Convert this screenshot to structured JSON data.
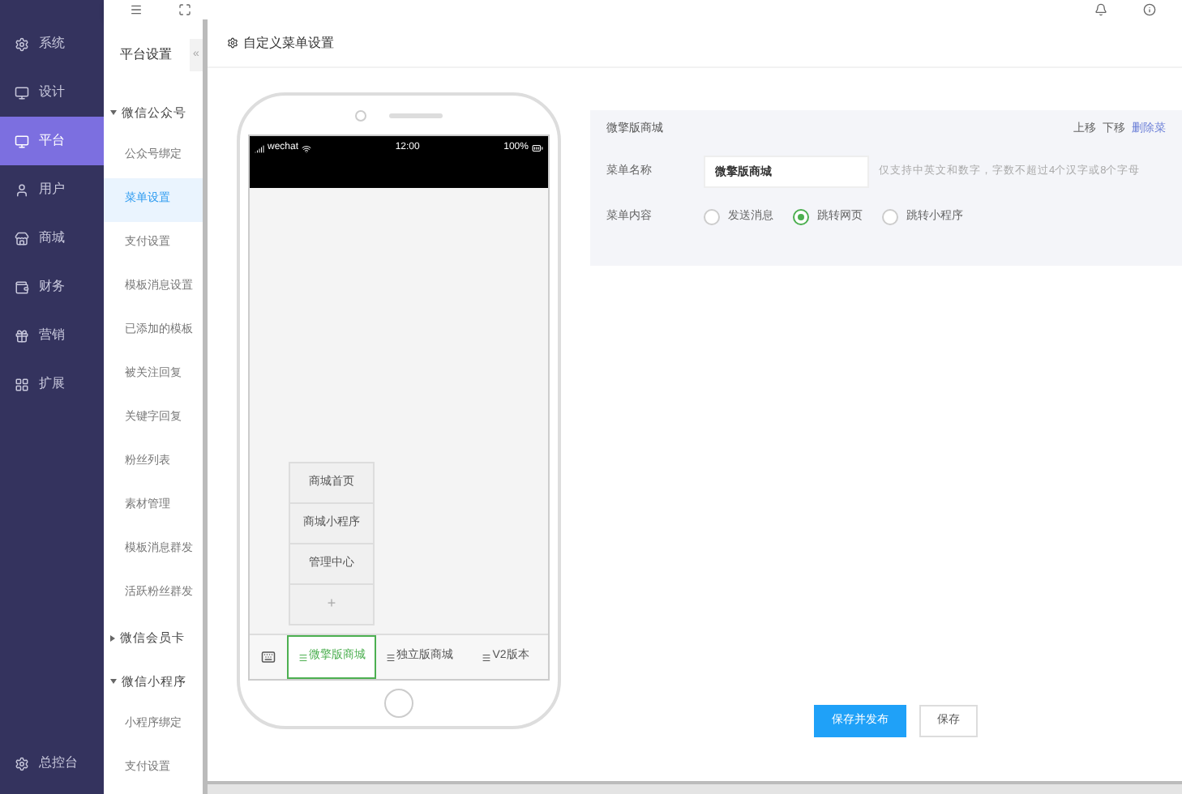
{
  "sidebar": {
    "items": [
      {
        "label": "系统",
        "selected": false
      },
      {
        "label": "设计",
        "selected": false
      },
      {
        "label": "平台",
        "selected": true
      },
      {
        "label": "用户",
        "selected": false
      },
      {
        "label": "商城",
        "selected": false
      },
      {
        "label": "财务",
        "selected": false
      },
      {
        "label": "营销",
        "selected": false
      },
      {
        "label": "扩展",
        "selected": false
      }
    ],
    "footer": "总控台"
  },
  "subnav": {
    "title": "平台设置",
    "collapse": "«",
    "groups": [
      {
        "label": "微信公众号",
        "expanded": true,
        "children": [
          {
            "label": "公众号绑定",
            "selected": false
          },
          {
            "label": "菜单设置",
            "selected": true
          },
          {
            "label": "支付设置",
            "selected": false
          },
          {
            "label": "模板消息设置",
            "selected": false
          },
          {
            "label": "已添加的模板",
            "selected": false
          },
          {
            "label": "被关注回复",
            "selected": false
          },
          {
            "label": "关键字回复",
            "selected": false
          },
          {
            "label": "粉丝列表",
            "selected": false
          },
          {
            "label": "素材管理",
            "selected": false
          },
          {
            "label": "模板消息群发",
            "selected": false
          },
          {
            "label": "活跃粉丝群发",
            "selected": false
          }
        ]
      },
      {
        "label": "微信会员卡",
        "expanded": false
      },
      {
        "label": "微信小程序",
        "expanded": true,
        "children": [
          {
            "label": "小程序绑定",
            "selected": false
          },
          {
            "label": "支付设置",
            "selected": false
          }
        ]
      }
    ]
  },
  "page_title": "自定义菜单设置",
  "phone": {
    "status": {
      "carrier": "wechat",
      "time": "12:00",
      "battery": "100%"
    },
    "submenu": [
      "商城首页",
      "商城小程序",
      "管理中心"
    ],
    "add": "+",
    "menu": [
      {
        "label": "微擎版商城",
        "selected": true
      },
      {
        "label": "独立版商城",
        "selected": false
      },
      {
        "label": "V2版本",
        "selected": false
      }
    ]
  },
  "editor": {
    "title": "微擎版商城",
    "actions": [
      {
        "label": "上移",
        "kind": "plain"
      },
      {
        "label": "下移",
        "kind": "plain"
      },
      {
        "label": "删除菜",
        "kind": "link"
      }
    ],
    "name_label": "菜单名称",
    "name_value": "微擎版商城",
    "name_hint": "仅支持中英文和数字，字数不超过4个汉字或8个字母",
    "content_label": "菜单内容",
    "options": [
      {
        "label": "发送消息",
        "selected": false
      },
      {
        "label": "跳转网页",
        "selected": true
      },
      {
        "label": "跳转小程序",
        "selected": false
      }
    ]
  },
  "buttons": [
    {
      "label": "保存并发布",
      "kind": "primary"
    },
    {
      "label": "保存",
      "kind": "default"
    }
  ]
}
